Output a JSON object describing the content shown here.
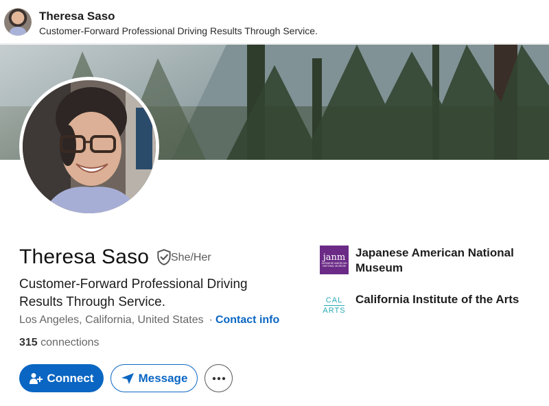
{
  "sticky_header": {
    "name": "Theresa Saso",
    "headline": "Customer-Forward Professional Driving Results Through Service."
  },
  "profile": {
    "name": "Theresa Saso",
    "pronouns": "She/Her",
    "headline": "Customer-Forward Professional Driving Results Through Service.",
    "location": "Los Angeles, California, United States",
    "separator": "·",
    "contact_info_label": "Contact info",
    "connections_count": "315",
    "connections_label": "connections"
  },
  "actions": {
    "connect_label": "Connect",
    "message_label": "Message",
    "more_icon": "more-horizontal-icon"
  },
  "organizations": [
    {
      "name": "Japanese American National Museum",
      "logo_text": "janm",
      "logo_subtext": "JAPANESE AMERICAN NATIONAL MUSEUM"
    },
    {
      "name": "California Institute of the Arts",
      "logo_top": "CAL",
      "logo_bottom": "ARTS"
    }
  ],
  "colors": {
    "brand_blue": "#0a66c2",
    "janm_purple": "#6b2a86",
    "calarts_teal": "#27a9b4"
  }
}
